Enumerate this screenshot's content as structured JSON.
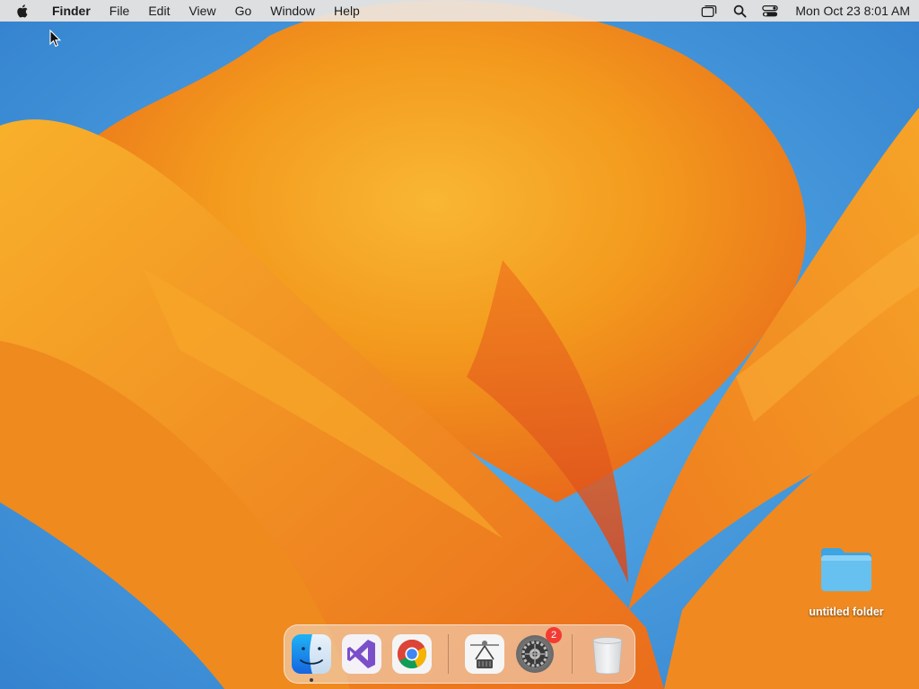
{
  "menubar": {
    "apple_icon": "apple-logo-icon",
    "app_name": "Finder",
    "menus": [
      "File",
      "Edit",
      "View",
      "Go",
      "Window",
      "Help"
    ],
    "status_icons": [
      "screen-mirroring-icon",
      "spotlight-search-icon",
      "control-center-icon"
    ],
    "clock": "Mon Oct 23  8:01 AM"
  },
  "desktop": {
    "items": [
      {
        "label": "untitled folder",
        "icon": "folder-icon"
      }
    ]
  },
  "dock": {
    "items": [
      {
        "name": "Finder",
        "icon": "finder-icon",
        "running": true
      },
      {
        "name": "Visual Studio",
        "icon": "visual-studio-icon",
        "running": false
      },
      {
        "name": "Google Chrome",
        "icon": "chrome-icon",
        "running": false
      },
      {
        "name": "Crane Tool",
        "icon": "crane-claw-icon",
        "running": false
      },
      {
        "name": "System Settings",
        "icon": "gear-icon",
        "running": false,
        "badge": "2"
      },
      {
        "name": "Trash",
        "icon": "trash-icon",
        "running": false
      }
    ]
  },
  "colors": {
    "wallpaper_orange": "#f28a18",
    "wallpaper_blue": "#3c8fd8",
    "badge_red": "#f23b33",
    "folder_blue": "#5fb8ec"
  }
}
